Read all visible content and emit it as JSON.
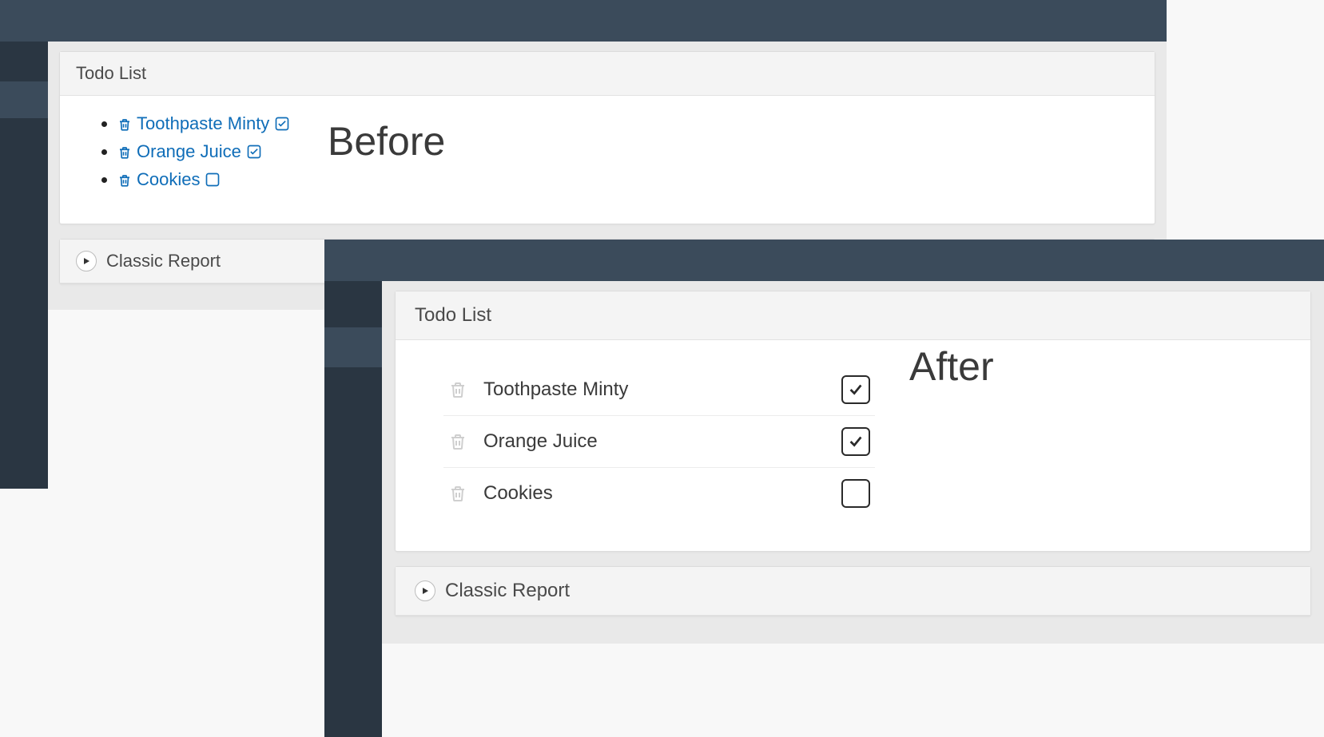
{
  "captions": {
    "before": "Before",
    "after": "After"
  },
  "before": {
    "todo_region_title": "Todo List",
    "classic_report_title": "Classic Report",
    "items": [
      {
        "label": "Toothpaste Minty",
        "checked": true
      },
      {
        "label": "Orange Juice",
        "checked": true
      },
      {
        "label": "Cookies",
        "checked": false
      }
    ]
  },
  "after": {
    "todo_region_title": "Todo List",
    "classic_report_title": "Classic Report",
    "items": [
      {
        "label": "Toothpaste Minty",
        "checked": true
      },
      {
        "label": "Orange Juice",
        "checked": true
      },
      {
        "label": "Cookies",
        "checked": false
      }
    ]
  },
  "icons": {
    "trash": "trash-icon",
    "checkbox_checked": "checkbox-checked-icon",
    "checkbox_unchecked": "checkbox-unchecked-icon",
    "play": "play-icon"
  }
}
